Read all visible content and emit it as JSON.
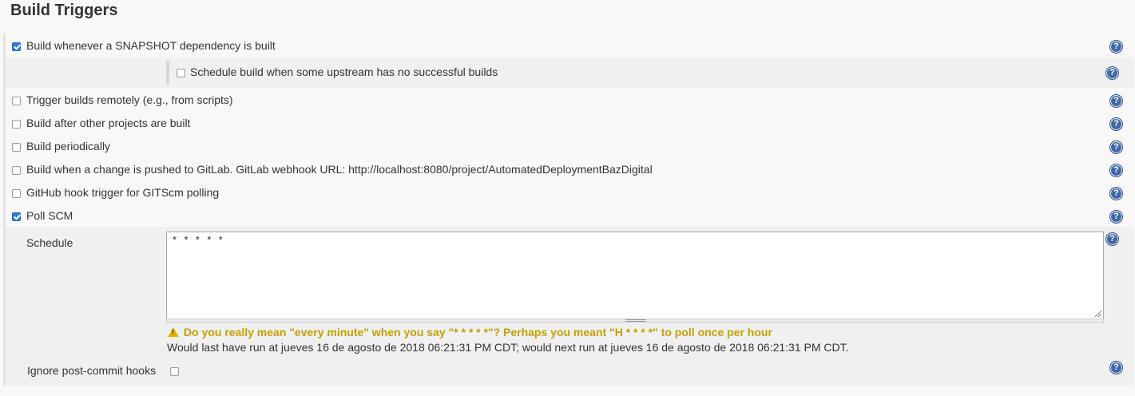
{
  "section": {
    "title": "Build Triggers"
  },
  "triggers": [
    {
      "label": "Build whenever a SNAPSHOT dependency is built",
      "checked": true
    },
    {
      "label": "Schedule build when some upstream has no successful builds",
      "checked": false
    },
    {
      "label": "Trigger builds remotely (e.g., from scripts)",
      "checked": false
    },
    {
      "label": "Build after other projects are built",
      "checked": false
    },
    {
      "label": "Build periodically",
      "checked": false
    },
    {
      "label": "Build when a change is pushed to GitLab. GitLab webhook URL: http://localhost:8080/project/AutomatedDeploymentBazDigital",
      "checked": false
    },
    {
      "label": "GitHub hook trigger for GITScm polling",
      "checked": false
    },
    {
      "label": "Poll SCM",
      "checked": true
    }
  ],
  "poll_scm": {
    "schedule_label": "Schedule",
    "schedule_value": "* * * * *",
    "warning": "Do you really mean \"every minute\" when you say \"* * * * *\"? Perhaps you meant \"H * * * *\" to poll once per hour",
    "info": "Would last have run at jueves 16 de agosto de 2018 06:21:31 PM CDT; would next run at jueves 16 de agosto de 2018 06:21:31 PM CDT.",
    "ignore_label": "Ignore post-commit hooks",
    "ignore_checked": false
  },
  "help_icon": "help-icon",
  "colors": {
    "accent": "#2a7de1",
    "warning": "#c4a000",
    "help": "#3e67a8"
  }
}
